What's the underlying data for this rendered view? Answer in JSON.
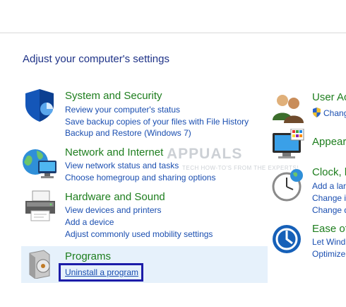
{
  "heading": "Adjust your computer's settings",
  "left_categories": [
    {
      "title": "System and Security",
      "icon": "shield-icon",
      "links": [
        "Review your computer's status",
        "Save backup copies of your files with File History",
        "Backup and Restore (Windows 7)"
      ]
    },
    {
      "title": "Network and Internet",
      "icon": "globe-network-icon",
      "links": [
        "View network status and tasks",
        "Choose homegroup and sharing options"
      ]
    },
    {
      "title": "Hardware and Sound",
      "icon": "printer-icon",
      "links": [
        "View devices and printers",
        "Add a device",
        "Adjust commonly used mobility settings"
      ]
    },
    {
      "title": "Programs",
      "icon": "programs-disc-icon",
      "links": [
        "Uninstall a program"
      ]
    }
  ],
  "right_categories": [
    {
      "title": "User Ac",
      "icon": "users-icon",
      "links": [
        "Chang"
      ]
    },
    {
      "title": "Appear",
      "icon": "monitor-icon",
      "links": []
    },
    {
      "title": "Clock, l",
      "icon": "clock-icon",
      "links": [
        "Add a lar",
        "Change i",
        "Change d"
      ]
    },
    {
      "title": "Ease of",
      "icon": "accessibility-icon",
      "links": [
        "Let Wind",
        "Optimize"
      ]
    }
  ],
  "watermark": {
    "brand": "APPUALS",
    "tagline": "TECH HOW-TO'S FROM THE EXPERTS!"
  },
  "colors": {
    "category_title": "#1e7e1e",
    "link": "#1a4eb0",
    "heading": "#1e3287",
    "highlight_box": "#1c1ca8",
    "selected_bg": "#e6f1fb"
  }
}
